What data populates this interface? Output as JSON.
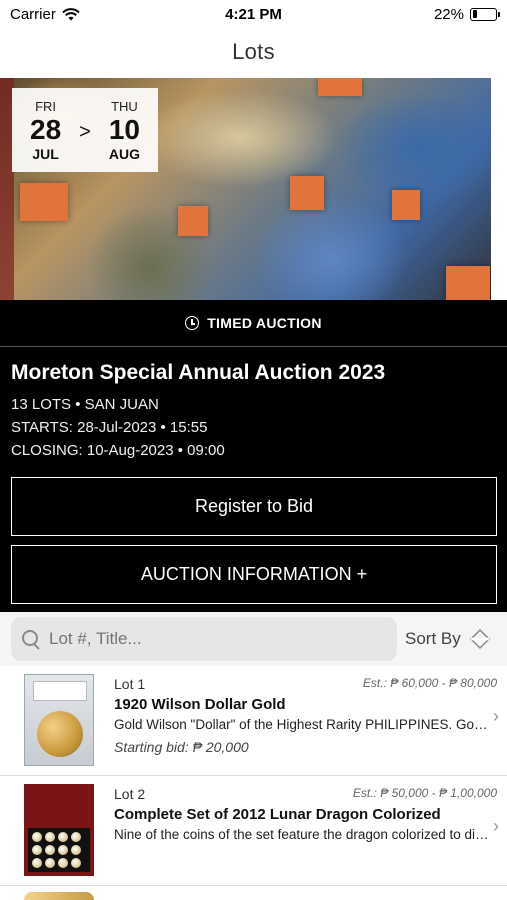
{
  "status_bar": {
    "carrier": "Carrier",
    "time": "4:21 PM",
    "battery": "22%",
    "battery_level": 0.22
  },
  "nav": {
    "title": "Lots"
  },
  "hero": {
    "start": {
      "dow": "FRI",
      "day": "28",
      "month": "JUL"
    },
    "arrow": ">",
    "end": {
      "dow": "THU",
      "day": "10",
      "month": "AUG"
    }
  },
  "auction": {
    "type_label": "TIMED AUCTION",
    "title": "Moreton Special Annual Auction 2023",
    "lots_location": "13 LOTS • SAN JUAN",
    "starts": "STARTS: 28-Jul-2023 • 15:55",
    "closing": "CLOSING: 10-Aug-2023 • 09:00",
    "register_label": "Register to Bid",
    "info_label": "AUCTION INFORMATION +"
  },
  "search": {
    "placeholder": "Lot #, Title...",
    "sort_label": "Sort By"
  },
  "lots": [
    {
      "number": "Lot 1",
      "estimate": "Est.: ₱ 60,000 - ₱ 80,000",
      "title": "1920 Wilson Dollar Gold",
      "description": "Gold Wilson \"Dollar\" of the Highest Rarity PHILIPPINES. Gold...",
      "starting_bid": "Starting bid: ₱ 20,000"
    },
    {
      "number": "Lot 2",
      "estimate": "Est.: ₱ 50,000 - ₱ 1,00,000",
      "title": "Complete Set of 2012 Lunar Dragon Colorized",
      "description": "Nine of the coins of the set feature the dragon colorized to dis..."
    }
  ],
  "icons": {
    "wifi": "wifi-icon",
    "battery": "battery-icon",
    "clock": "clock-icon",
    "search": "search-icon",
    "sort": "sort-icon",
    "chevron": "chevron-right-icon"
  }
}
